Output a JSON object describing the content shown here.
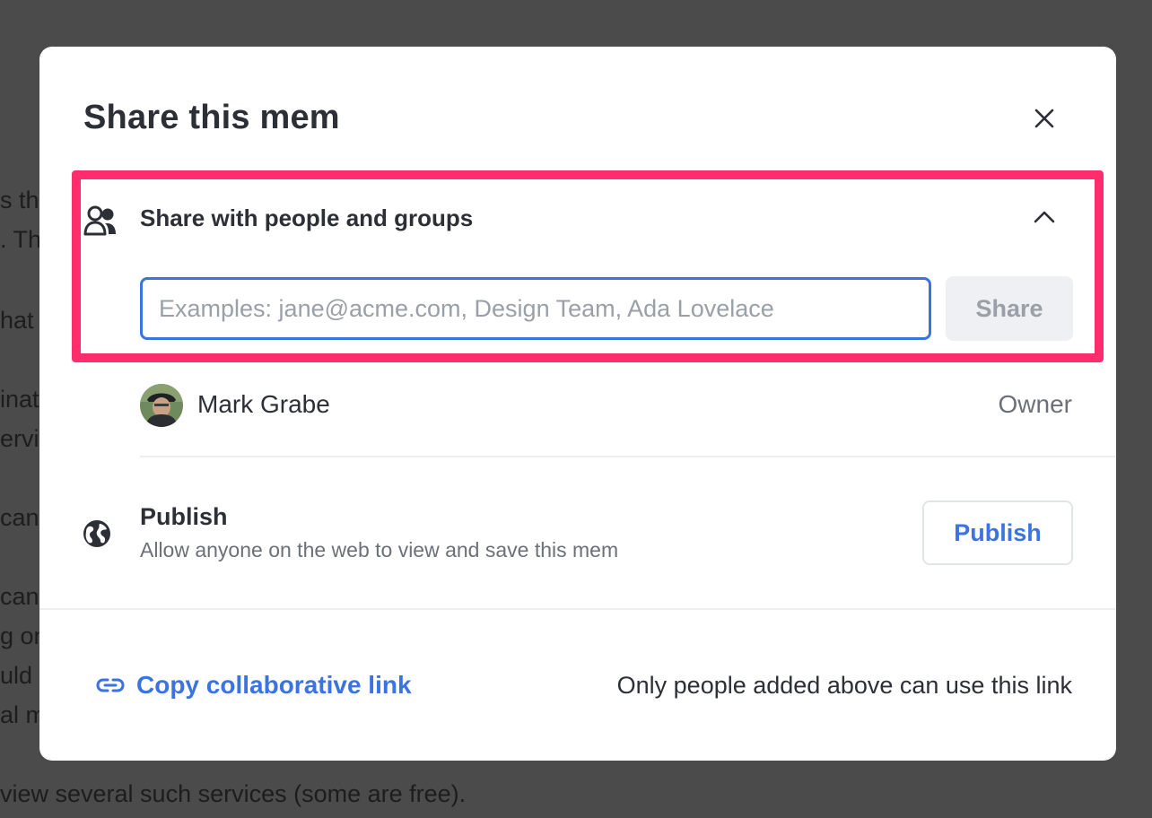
{
  "background_text": {
    "lines": [
      "s th",
      ". Th",
      "hat",
      "inat",
      "ervi",
      "can",
      "can",
      "g on",
      "uld",
      "al m"
    ],
    "bottom": "view several such services (some are free)."
  },
  "modal": {
    "title": "Share this mem",
    "close_icon": "close-icon"
  },
  "share_section": {
    "title": "Share with people and groups",
    "input_placeholder": "Examples: jane@acme.com, Design Team, Ada Lovelace",
    "share_button": "Share",
    "highlight_color": "#ff2d6c"
  },
  "members": [
    {
      "name": "Mark Grabe",
      "role": "Owner"
    }
  ],
  "publish": {
    "title": "Publish",
    "description": "Allow anyone on the web to view and save this mem",
    "button": "Publish"
  },
  "footer": {
    "copy_link": "Copy collaborative link",
    "note": "Only people added above can use this link"
  },
  "colors": {
    "accent": "#3b73e0",
    "highlight": "#ff2d6c",
    "text": "#2c2f36",
    "muted": "#6b7079"
  }
}
